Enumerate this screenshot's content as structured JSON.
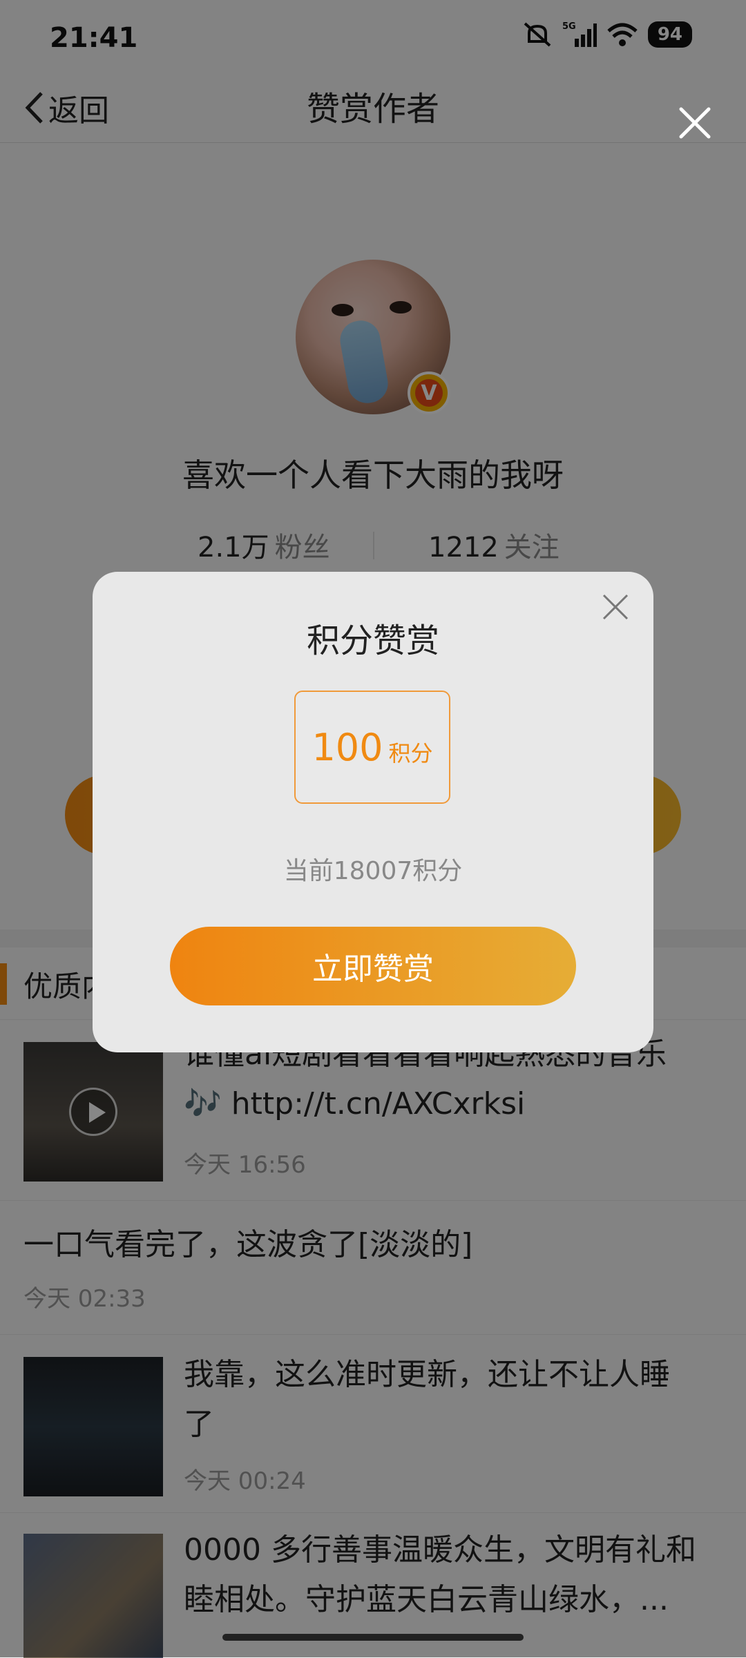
{
  "status_bar": {
    "time": "21:41",
    "battery": "94",
    "network": "5G"
  },
  "nav": {
    "back_label": "返回",
    "title": "赞赏作者"
  },
  "profile": {
    "username": "喜欢一个人看下大雨的我呀",
    "fans_count": "2.1万",
    "fans_label": "粉丝",
    "following_count": "1212",
    "following_label": "关注",
    "verified_badge": "V"
  },
  "section": {
    "title": "优质内容"
  },
  "feed": [
    {
      "text_line1": "谁懂ai短剧看看看看响起熟悉的音乐",
      "text_line2": "🎶 http://t.cn/AXCxrksi",
      "time": "今天 16:56"
    },
    {
      "text": "一口气看完了，这波贪了[淡淡的]",
      "time": "今天 02:33"
    },
    {
      "text_line1": "我靠，这么准时更新，还让不让人睡",
      "text_line2": "了",
      "time": "今天 00:24"
    },
    {
      "text_line1": "0000 多行善事温暖众生，文明有礼和",
      "text_line2": "睦相处。守护蓝天白云青山绿水，..."
    }
  ],
  "modal": {
    "title": "积分赞赏",
    "amount": "100",
    "amount_unit": "积分",
    "balance": "当前18007积分",
    "confirm_label": "立即赞赏"
  },
  "colors": {
    "accent": "#f08a12",
    "accent_end": "#e6ad36",
    "overlay": "rgba(0,0,0,0.47)"
  },
  "icons": [
    "back-chevron-icon",
    "close-icon",
    "mute-icon",
    "signal-icon",
    "wifi-icon",
    "play-icon",
    "verified-badge-icon"
  ]
}
